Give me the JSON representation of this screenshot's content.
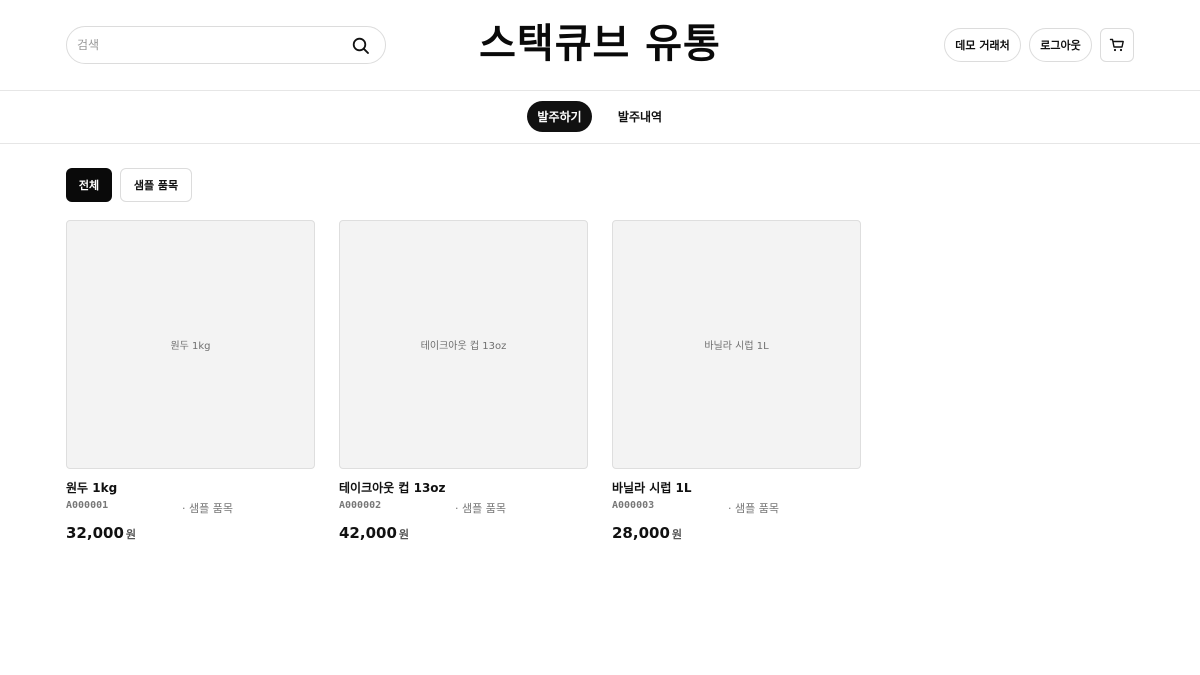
{
  "header": {
    "search_placeholder": "검색",
    "brand": "스택큐브 유통",
    "demo_label": "데모 거래처",
    "logout_label": "로그아웃"
  },
  "nav": {
    "tabs": [
      {
        "label": "발주하기",
        "active": true
      },
      {
        "label": "발주내역",
        "active": false
      }
    ]
  },
  "filters": [
    {
      "label": "전체",
      "active": true
    },
    {
      "label": "샘플 품목",
      "active": false
    }
  ],
  "products": [
    {
      "thumb_label": "원두 1kg",
      "name": "원두 1kg",
      "code": "A000001",
      "category": "· 샘플 품목",
      "price": "32,000",
      "unit": "원"
    },
    {
      "thumb_label": "테이크아웃 컵 13oz",
      "name": "테이크아웃 컵 13oz",
      "code": "A000002",
      "category": "· 샘플 품목",
      "price": "42,000",
      "unit": "원"
    },
    {
      "thumb_label": "바닐라 시럽 1L",
      "name": "바닐라 시럽 1L",
      "code": "A000003",
      "category": "· 샘플 품목",
      "price": "28,000",
      "unit": "원"
    }
  ],
  "icons": {
    "search": "search-icon",
    "cart": "cart-icon"
  },
  "colors": {
    "active_bg": "#111111",
    "thumb_bg": "#f3f3f3",
    "border": "#dcdcdc"
  }
}
